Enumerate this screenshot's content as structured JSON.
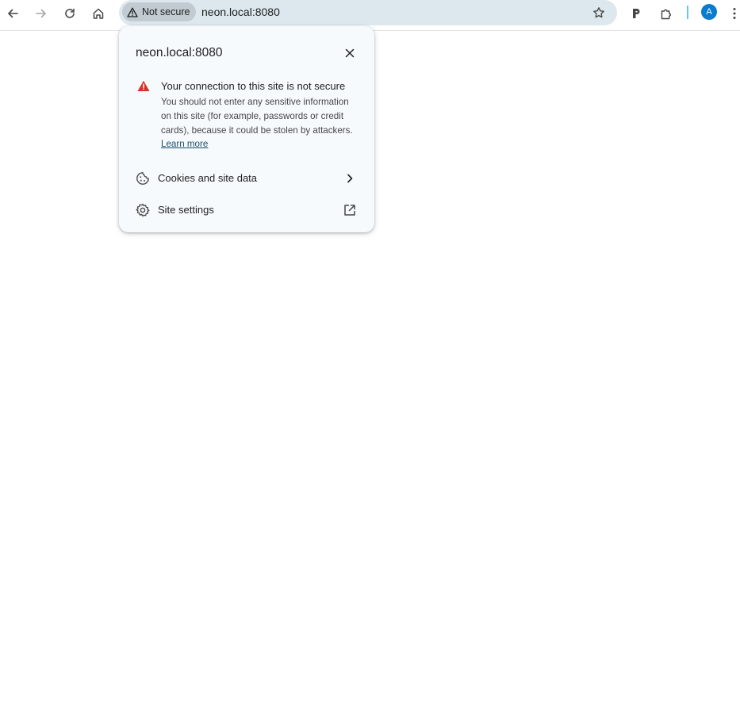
{
  "browser": {
    "security_chip_label": "Not secure",
    "url": "neon.local:8080",
    "profile_initial": "A",
    "icons": {
      "back": "back-arrow-icon",
      "forward": "forward-arrow-icon",
      "reload": "reload-icon",
      "home": "home-icon",
      "warning": "warning-triangle-icon",
      "bookmark": "star-icon",
      "extension_p": "p-extension-icon",
      "extensions": "puzzle-icon",
      "menu": "kebab-menu-icon"
    },
    "colors": {
      "omnibox_bg": "#dde8ee",
      "chip_bg": "#c1cbd1",
      "avatar_bg": "#0b7bd0",
      "divider": "#6fc4ea"
    }
  },
  "site_info_popup": {
    "title": "neon.local:8080",
    "warning": {
      "heading": "Your connection to this site is not secure",
      "body": "You should not enter any sensitive information on this site (for example, passwords or credit cards), because it could be stolen by attackers.",
      "link": "Learn more",
      "icon_color": "#d93025"
    },
    "rows": [
      {
        "label": "Cookies and site data",
        "icon": "cookie-icon",
        "trail_icon": "chevron-right-icon"
      },
      {
        "label": "Site settings",
        "icon": "gear-icon",
        "trail_icon": "external-link-icon"
      }
    ]
  }
}
